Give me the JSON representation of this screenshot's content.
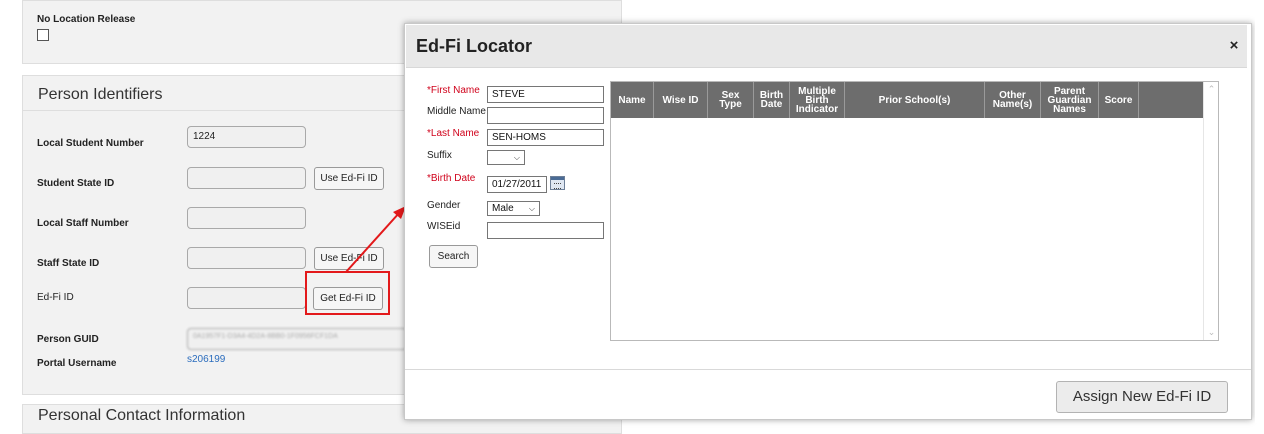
{
  "background": {
    "no_location_release": {
      "label": "No Location Release"
    },
    "person_identifiers": {
      "title": "Person Identifiers",
      "local_student_number": {
        "label": "Local Student Number",
        "value": "1224"
      },
      "student_state_id": {
        "label": "Student State ID",
        "value": "",
        "button": "Use Ed-Fi ID"
      },
      "local_staff_number": {
        "label": "Local Staff Number",
        "value": ""
      },
      "staff_state_id": {
        "label": "Staff State ID",
        "value": "",
        "button": "Use Ed-Fi ID"
      },
      "edfi_id": {
        "label": "Ed-Fi ID",
        "value": "",
        "button": "Get Ed-Fi ID"
      },
      "person_guid": {
        "label": "Person GUID",
        "value": "0A1957F1-D3A4-4D2A-8BB0-1F0956FCF1DA"
      },
      "portal_username": {
        "label": "Portal Username",
        "value": "s206199"
      }
    },
    "personal_contact": {
      "title": "Personal Contact Information"
    }
  },
  "modal": {
    "title": "Ed-Fi Locator",
    "close_glyph": "×",
    "form": {
      "first_name": {
        "label": "*First Name",
        "value": "STEVE"
      },
      "middle_name": {
        "label": "Middle Name",
        "value": ""
      },
      "last_name": {
        "label": "*Last Name",
        "value": "SEN-HOMS"
      },
      "suffix": {
        "label": "Suffix",
        "value": ""
      },
      "birth_date": {
        "label": "*Birth Date",
        "value": "01/27/2011"
      },
      "gender": {
        "label": "Gender",
        "value": "Male"
      },
      "wiseid": {
        "label": "WISEid",
        "value": ""
      },
      "search_button": "Search"
    },
    "results_columns": [
      "Name",
      "Wise ID",
      "Sex Type",
      "Birth Date",
      "Multiple Birth Indicator",
      "Prior School(s)",
      "Other Name(s)",
      "Parent Guardian Names",
      "Score",
      ""
    ],
    "assign_button": "Assign New Ed-Fi ID"
  },
  "colors": {
    "required_label": "#d0021b",
    "table_header": "#6d6d6d",
    "highlight": "#e3191b",
    "link": "#2a6cbd"
  }
}
